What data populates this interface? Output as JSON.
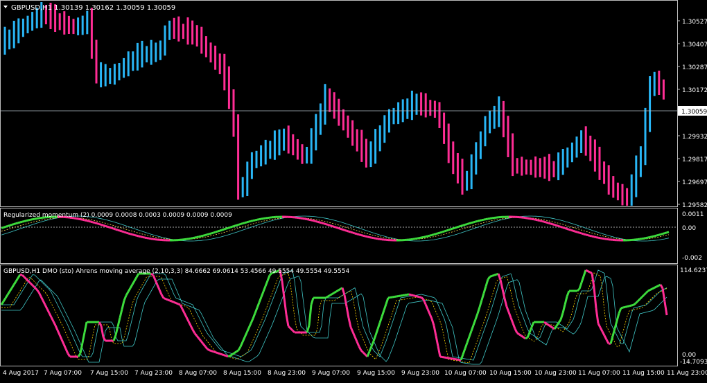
{
  "main": {
    "title": "GBPUSD,H1  1.30139 1.30162 1.30059 1.30059",
    "current_price": "1.30059",
    "price_labels": [
      "1.30527",
      "1.30407",
      "1.30287",
      "1.30172",
      "1.29932",
      "1.29817",
      "1.29697",
      "1.29582"
    ],
    "colors": {
      "up": "#29b6f6",
      "down": "#ff2d95"
    }
  },
  "momentum": {
    "title": "Regularized momentum (2) 0.0009 0.0008 0.0003 0.0009 0.0009 0.0009",
    "labels": [
      "0.0011",
      "0.00",
      "-0.002"
    ],
    "colors": {
      "up": "#3ddc3d",
      "down": "#ff2d95",
      "signal": "#40c8c8"
    }
  },
  "dmo": {
    "title": "GBPUSD,H1 DMO (sto) Ahrens moving average (2,10,3,3) 84.6662 69.0614 53.4566 49.5554 49.5554 49.5554",
    "labels": [
      "114.6237",
      "0.00",
      "-14.7093"
    ],
    "colors": {
      "up": "#3ddc3d",
      "down": "#ff2d95",
      "band": "#40c8c8",
      "mid": "#ffd700"
    }
  },
  "time_axis": [
    "4 Aug 2017",
    "7 Aug 07:00",
    "7 Aug 15:00",
    "7 Aug 23:00",
    "8 Aug 07:00",
    "8 Aug 15:00",
    "8 Aug 23:00",
    "9 Aug 07:00",
    "9 Aug 15:00",
    "9 Aug 23:00",
    "10 Aug 07:00",
    "10 Aug 15:00",
    "10 Aug 23:00",
    "11 Aug 07:00",
    "11 Aug 15:00",
    "11 Aug 23:00"
  ]
}
